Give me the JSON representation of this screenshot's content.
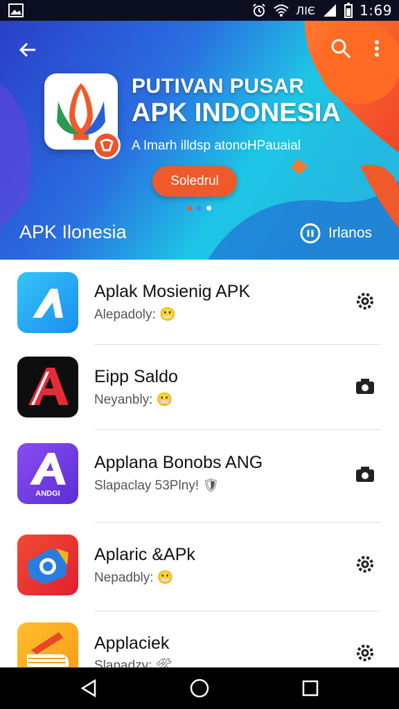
{
  "status_bar": {
    "network_text": "ЛΙЄ",
    "time": "1:69",
    "icons": [
      "image-icon",
      "alarm-icon",
      "wifi-icon",
      "signal-icon",
      "battery-icon"
    ]
  },
  "hero": {
    "title_line1": "PUTIVAN PUSAR",
    "title_line2": "APK INDONESIA",
    "subtitle": "A Imarh illdsp atonoHPauaial",
    "cta_label": "Soledrul",
    "caption": "APK Ilonesia",
    "link_label": "Irlanos",
    "colors": {
      "accent": "#f05a2a",
      "primary_blue": "#2a5fd8",
      "cyan": "#1ec6e6"
    }
  },
  "apps": [
    {
      "title": "Aplak Mosienig APK",
      "subtitle": "Alepadoly:",
      "icon": "blue-a-app-icon",
      "action_icon": "gear-icon"
    },
    {
      "title": "Eipp Saldo",
      "subtitle": "Neyanbly:",
      "icon": "red-a-app-icon",
      "action_icon": "camera-icon"
    },
    {
      "title": "Applana Bonobs ANG",
      "subtitle": "Slapaclay 53Plny!",
      "icon": "purple-a-app-icon",
      "icon_text": "ANDGI",
      "action_icon": "camera-icon"
    },
    {
      "title": "Aplaric &APk",
      "subtitle": "Nepadbly:",
      "icon": "red-camera-app-icon",
      "action_icon": "gear-icon"
    },
    {
      "title": "Applaciek",
      "subtitle": "Slapadzy:",
      "icon": "yellow-hand-app-icon",
      "action_icon": "gear-icon"
    }
  ]
}
